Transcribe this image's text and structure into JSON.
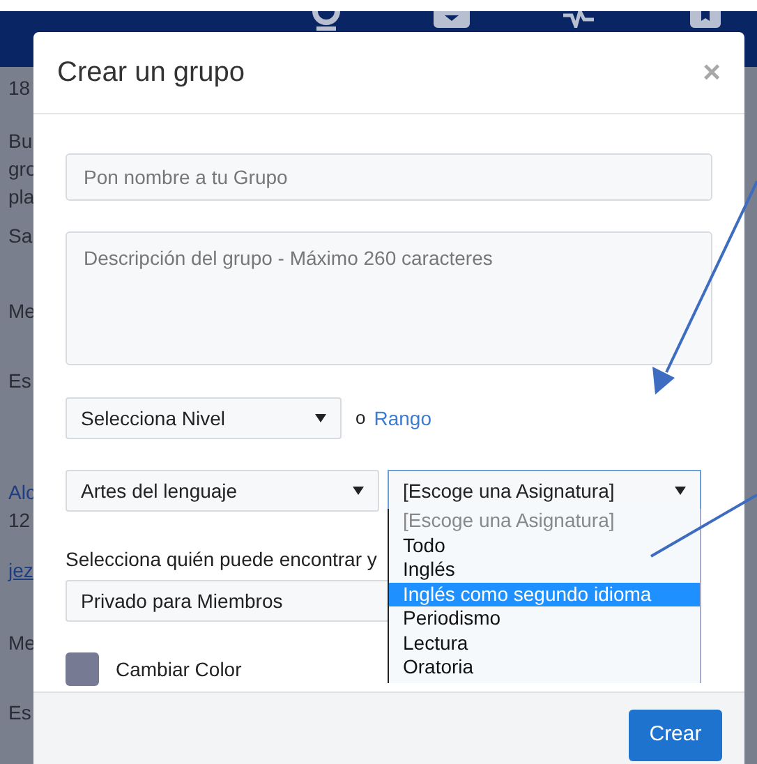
{
  "background_texts": [
    {
      "text": "18",
      "kind": "plain"
    },
    {
      "text": "Bu",
      "kind": "plain"
    },
    {
      "text": "gro",
      "kind": "plain"
    },
    {
      "text": "pla",
      "kind": "plain"
    },
    {
      "text": "Sa",
      "kind": "plain"
    },
    {
      "text": "Me",
      "kind": "plain"
    },
    {
      "text": "Es",
      "kind": "plain"
    },
    {
      "text": "Alc",
      "kind": "link"
    },
    {
      "text": "12",
      "kind": "plain"
    },
    {
      "text": "jez",
      "kind": "underlined-link"
    },
    {
      "text": "Me",
      "kind": "plain"
    },
    {
      "text": "Es",
      "kind": "plain"
    }
  ],
  "modal": {
    "title": "Crear un grupo",
    "close": "×",
    "name_field": {
      "placeholder": "Pon nombre a tu Grupo"
    },
    "description_field": {
      "placeholder": "Descripción del grupo - Máximo 260 caracteres"
    },
    "level_select": {
      "value": "Selecciona Nivel"
    },
    "or_text": "o",
    "range_link": "Rango",
    "subject_area_select": {
      "value": "Artes del lenguaje"
    },
    "subject_select": {
      "value": "[Escoge una Asignatura]",
      "expanded": true,
      "options": [
        {
          "label": "[Escoge una Asignatura]",
          "highlighted": false,
          "disabled": true
        },
        {
          "label": "Todo",
          "highlighted": false,
          "disabled": false
        },
        {
          "label": "Inglés",
          "highlighted": false,
          "disabled": false
        },
        {
          "label": "Inglés como segundo idioma",
          "highlighted": true,
          "disabled": false
        },
        {
          "label": "Periodismo",
          "highlighted": false,
          "disabled": false
        },
        {
          "label": "Lectura",
          "highlighted": false,
          "disabled": false
        },
        {
          "label": "Oratoria",
          "highlighted": false,
          "disabled": false
        }
      ]
    },
    "visibility_label": "Selecciona quién puede encontrar y",
    "visibility_select": {
      "value": "Privado para Miembros"
    },
    "color": {
      "label": "Cambiar Color",
      "color": "#767b93"
    },
    "submit_button": "Crear"
  }
}
